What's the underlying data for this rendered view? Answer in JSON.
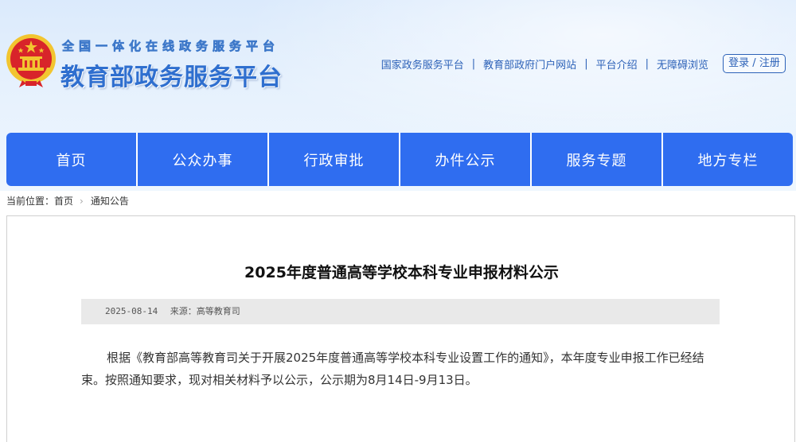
{
  "header": {
    "subtitle": "全国一体化在线政务服务平台",
    "title": "教育部政务服务平台",
    "links": [
      "国家政务服务平台",
      "教育部政府门户网站",
      "平台介绍",
      "无障碍浏览"
    ],
    "login_label": "登录 / 注册"
  },
  "nav": {
    "items": [
      "首页",
      "公众办事",
      "行政审批",
      "办件公示",
      "服务专题",
      "地方专栏"
    ]
  },
  "breadcrumb": {
    "prefix": "当前位置：",
    "home": "首页",
    "current": "通知公告"
  },
  "article": {
    "title": "2025年度普通高等学校本科专业申报材料公示",
    "date": "2025-08-14",
    "source": "来源：高等教育司",
    "body": "根据《教育部高等教育司关于开展2025年度普通高等学校本科专业设置工作的通知》，本年度专业申报工作已经结束。按照通知要求，现对相关材料予以公示，公示期为8月14日-9月13日。"
  },
  "colors": {
    "nav_blue": "#2f6df0",
    "link_blue": "#2d62b8",
    "emblem_red": "#d8242a",
    "emblem_gold": "#f2c530"
  },
  "icons": {
    "emblem": "national-emblem",
    "breadcrumb_separator": "chevron-right-icon"
  }
}
